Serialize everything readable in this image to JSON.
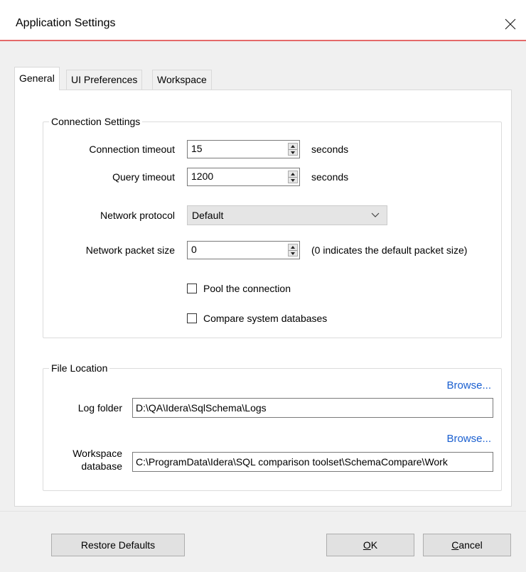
{
  "window": {
    "title": "Application Settings",
    "close_glyph": "close-icon"
  },
  "tabs": [
    {
      "label": "General",
      "active": true
    },
    {
      "label": "UI Preferences",
      "active": false
    },
    {
      "label": "Workspace",
      "active": false
    }
  ],
  "connection_settings": {
    "legend": "Connection Settings",
    "connection_timeout": {
      "label": "Connection timeout",
      "value": "15",
      "unit": "seconds"
    },
    "query_timeout": {
      "label": "Query timeout",
      "value": "1200",
      "unit": "seconds"
    },
    "network_protocol": {
      "label": "Network protocol",
      "value": "Default"
    },
    "network_packet_size": {
      "label": "Network packet size",
      "value": "0",
      "hint": "(0 indicates the default packet size)"
    },
    "pool_connection": {
      "label": "Pool the connection",
      "checked": false
    },
    "compare_system_databases": {
      "label": "Compare system databases",
      "checked": false
    }
  },
  "file_location": {
    "legend": "File Location",
    "log_folder": {
      "label": "Log folder",
      "value": "D:\\QA\\Idera\\SqlSchema\\Logs",
      "browse": "Browse..."
    },
    "workspace_database": {
      "label_line1": "Workspace",
      "label_line2": "database",
      "value": "C:\\ProgramData\\Idera\\SQL comparison toolset\\SchemaCompare\\Work",
      "browse": "Browse..."
    }
  },
  "footer": {
    "restore_defaults": "Restore Defaults",
    "ok_underlined": "O",
    "ok_rest": "K",
    "cancel_underlined": "C",
    "cancel_rest": "ancel"
  }
}
